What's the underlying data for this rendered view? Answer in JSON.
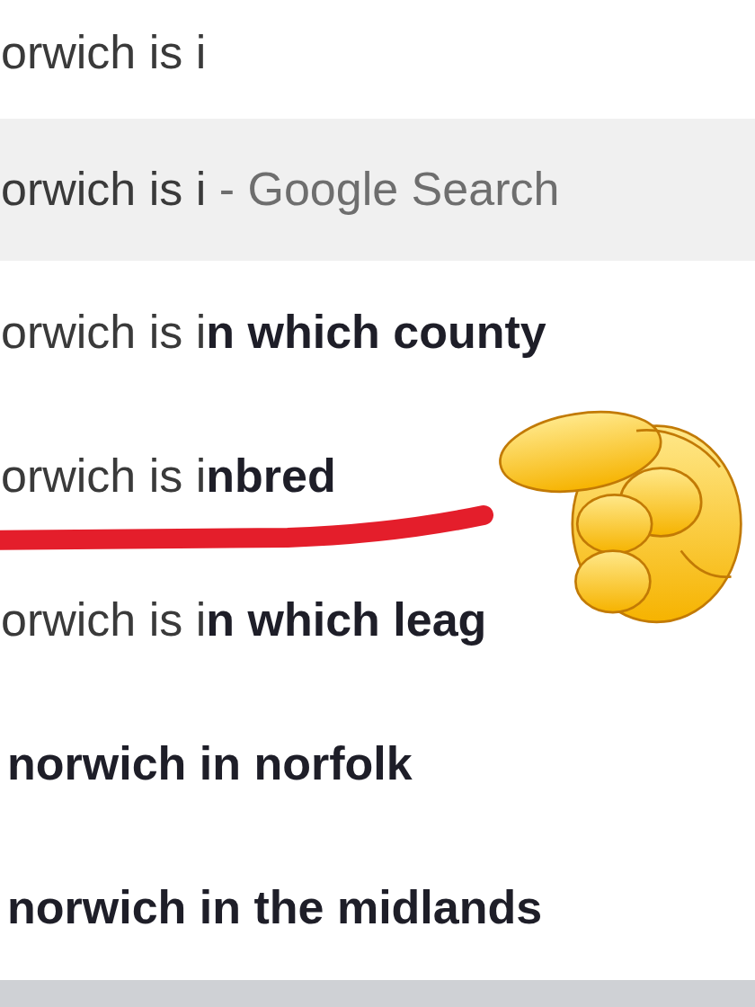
{
  "search_field": {
    "value": "orwich is i"
  },
  "suggestions": [
    {
      "kind": "search",
      "query": "orwich is i",
      "suffix": "- Google Search",
      "selected": true
    },
    {
      "kind": "completion",
      "query": "orwich is i",
      "completion": "n which county",
      "selected": false
    },
    {
      "kind": "completion",
      "query": "orwich is i",
      "completion": "nbred",
      "selected": false
    },
    {
      "kind": "completion",
      "query": "orwich is i",
      "completion": "n which leag",
      "selected": false
    },
    {
      "kind": "related",
      "completion": "norwich in norfolk",
      "selected": false
    },
    {
      "kind": "related",
      "completion": "norwich in the midlands",
      "selected": false
    }
  ]
}
